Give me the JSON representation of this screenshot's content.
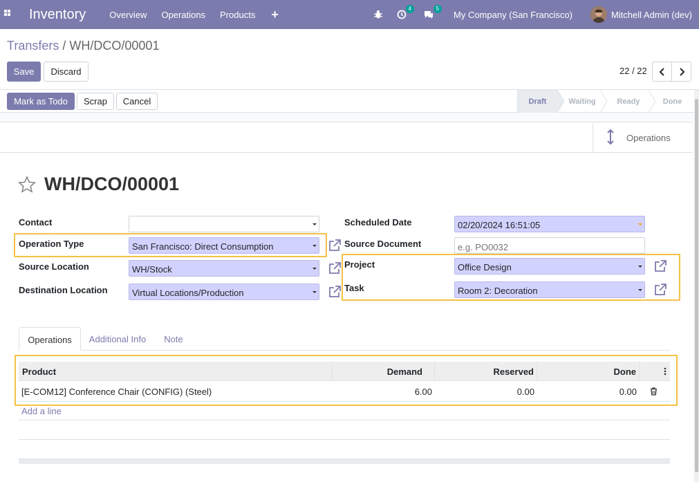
{
  "navbar": {
    "app_name": "Inventory",
    "menu": [
      "Overview",
      "Operations",
      "Products"
    ],
    "plus_icon": "+",
    "activity_count": "4",
    "message_count": "5",
    "company": "My Company (San Francisco)",
    "user": "Mitchell Admin (dev)",
    "color": "#7c7bad"
  },
  "control_panel": {
    "breadcrumb_parent": "Transfers",
    "breadcrumb_separator": "/",
    "breadcrumb_current": "WH/DCO/00001",
    "save_label": "Save",
    "discard_label": "Discard",
    "pager": "22 / 22"
  },
  "statusbar": {
    "buttons": [
      "Mark as Todo",
      "Scrap",
      "Cancel"
    ],
    "stages": [
      "Draft",
      "Waiting",
      "Ready",
      "Done"
    ],
    "active_stage": "Draft"
  },
  "smart_button": {
    "label": "Operations"
  },
  "record": {
    "title": "WH/DCO/00001",
    "left_fields": [
      {
        "label": "Contact",
        "value": ""
      },
      {
        "label": "Operation Type",
        "value": "San Francisco: Direct Consumption"
      },
      {
        "label": "Source Location",
        "value": "WH/Stock"
      },
      {
        "label": "Destination Location",
        "value": "Virtual Locations/Production"
      }
    ],
    "right_fields": [
      {
        "label": "Scheduled Date",
        "value": "02/20/2024 16:51:05"
      },
      {
        "label": "Source Document",
        "value": "",
        "placeholder": "e.g. PO0032"
      },
      {
        "label": "Project",
        "value": "Office Design"
      },
      {
        "label": "Task",
        "value": "Room 2: Decoration"
      }
    ]
  },
  "tabs": [
    "Operations",
    "Additional Info",
    "Note"
  ],
  "table": {
    "columns": [
      "Product",
      "Demand",
      "Reserved",
      "Done"
    ],
    "rows": [
      {
        "product": "[E-COM12] Conference Chair (CONFIG) (Steel)",
        "demand": "6.00",
        "reserved": "0.00",
        "done": "0.00"
      }
    ],
    "add_line": "Add a line"
  },
  "highlight_color": "#f5c145"
}
